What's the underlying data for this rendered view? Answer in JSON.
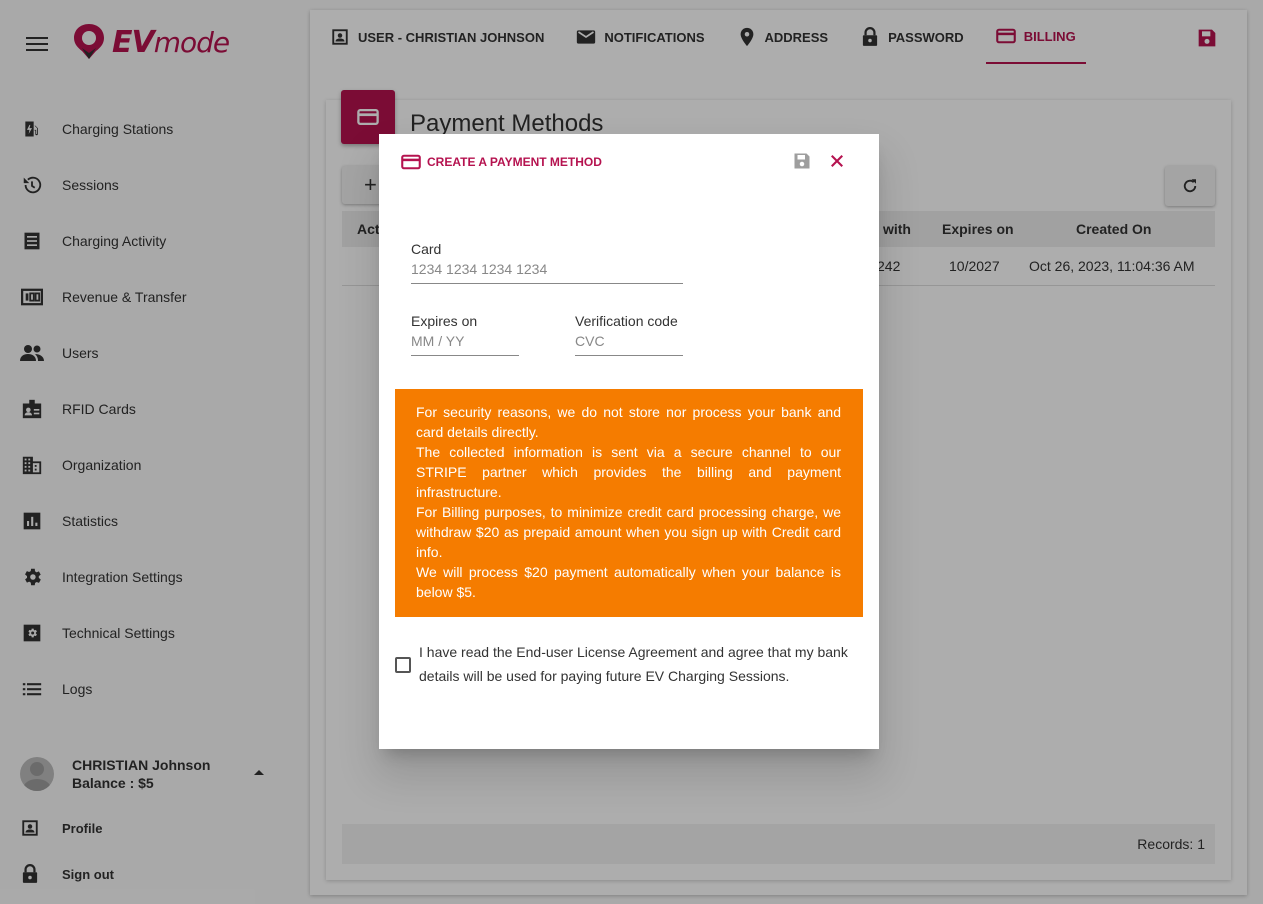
{
  "brand": {
    "name_prefix": "EV",
    "name_suffix": "mode",
    "color": "#b5124f"
  },
  "sidebar": {
    "items": [
      {
        "label": "Charging Stations",
        "icon": "ev-station-icon"
      },
      {
        "label": "Sessions",
        "icon": "history-icon"
      },
      {
        "label": "Charging Activity",
        "icon": "receipt-icon"
      },
      {
        "label": "Revenue & Transfer",
        "icon": "money-icon"
      },
      {
        "label": "Users",
        "icon": "people-icon"
      },
      {
        "label": "RFID Cards",
        "icon": "badge-icon"
      },
      {
        "label": "Organization",
        "icon": "business-icon"
      },
      {
        "label": "Statistics",
        "icon": "chart-icon"
      },
      {
        "label": "Integration Settings",
        "icon": "settings-icon"
      },
      {
        "label": "Technical Settings",
        "icon": "technical-settings-icon"
      },
      {
        "label": "Logs",
        "icon": "list-icon"
      }
    ],
    "user": {
      "name": "CHRISTIAN Johnson",
      "balance": "Balance : $5"
    },
    "profile_label": "Profile",
    "signout_label": "Sign out"
  },
  "tabs": [
    {
      "label": "USER - CHRISTIAN JOHNSON",
      "icon": "account-box-icon",
      "active": false
    },
    {
      "label": "NOTIFICATIONS",
      "icon": "mail-icon",
      "active": false
    },
    {
      "label": "ADDRESS",
      "icon": "location-icon",
      "active": false
    },
    {
      "label": "PASSWORD",
      "icon": "lock-icon",
      "active": false
    },
    {
      "label": "BILLING",
      "icon": "credit-card-icon",
      "active": true
    }
  ],
  "page": {
    "title": "Payment Methods",
    "add_label": "+",
    "table": {
      "headers": {
        "actions": "Act",
        "ending": "ng with",
        "expires": "Expires on",
        "created": "Created On"
      },
      "rows": [
        {
          "ending": "242",
          "expires": "10/2027",
          "created": "Oct 26, 2023, 11:04:36 AM"
        }
      ]
    },
    "records": "Records: 1"
  },
  "dialog": {
    "title": "CREATE A PAYMENT METHOD",
    "card_label": "Card",
    "card_placeholder": "1234 1234 1234 1234",
    "expires_label": "Expires on",
    "expires_placeholder": "MM / YY",
    "cvc_label": "Verification code",
    "cvc_placeholder": "CVC",
    "warning": [
      "For security reasons, we do not store nor process your bank and card details directly.",
      "The collected information is sent via a secure channel to our STRIPE partner which provides the billing and payment infrastructure.",
      "For Billing purposes, to minimize credit card processing charge, we withdraw $20 as prepaid amount when you sign up with Credit card info.",
      "We will process $20 payment automatically when your balance is below $5."
    ],
    "agreement": "I have read the End-user License Agreement and agree that my bank details will be used for paying future EV Charging Sessions.",
    "warning_color": "#f57c00"
  }
}
